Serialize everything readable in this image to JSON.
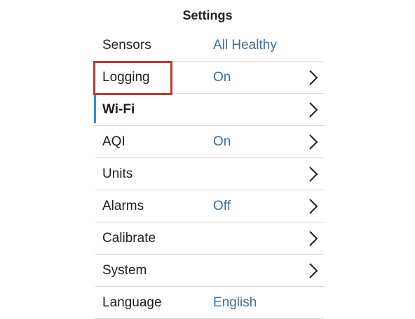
{
  "title": "Settings",
  "colors": {
    "value_text": "#3d6e9e",
    "selection_bar": "#2f8fe0",
    "highlight_box": "#c0392b",
    "divider": "#d9d9d9"
  },
  "rows": [
    {
      "label": "Sensors",
      "value": "All Healthy",
      "chevron": false,
      "chevron_icon": ""
    },
    {
      "label": "Logging",
      "value": "On",
      "chevron": true,
      "chevron_icon": "chevron-right-icon"
    },
    {
      "label": "Wi-Fi",
      "value": "",
      "chevron": true,
      "chevron_icon": "chevron-right-icon",
      "selected": true
    },
    {
      "label": "AQI",
      "value": "On",
      "chevron": true,
      "chevron_icon": "chevron-right-icon"
    },
    {
      "label": "Units",
      "value": "",
      "chevron": true,
      "chevron_icon": "chevron-right-icon"
    },
    {
      "label": "Alarms",
      "value": "Off",
      "chevron": true,
      "chevron_icon": "chevron-right-icon"
    },
    {
      "label": "Calibrate",
      "value": "",
      "chevron": true,
      "chevron_icon": "chevron-right-icon"
    },
    {
      "label": "System",
      "value": "",
      "chevron": true,
      "chevron_icon": "chevron-right-icon"
    },
    {
      "label": "Language",
      "value": "English",
      "chevron": false,
      "chevron_icon": ""
    }
  ]
}
